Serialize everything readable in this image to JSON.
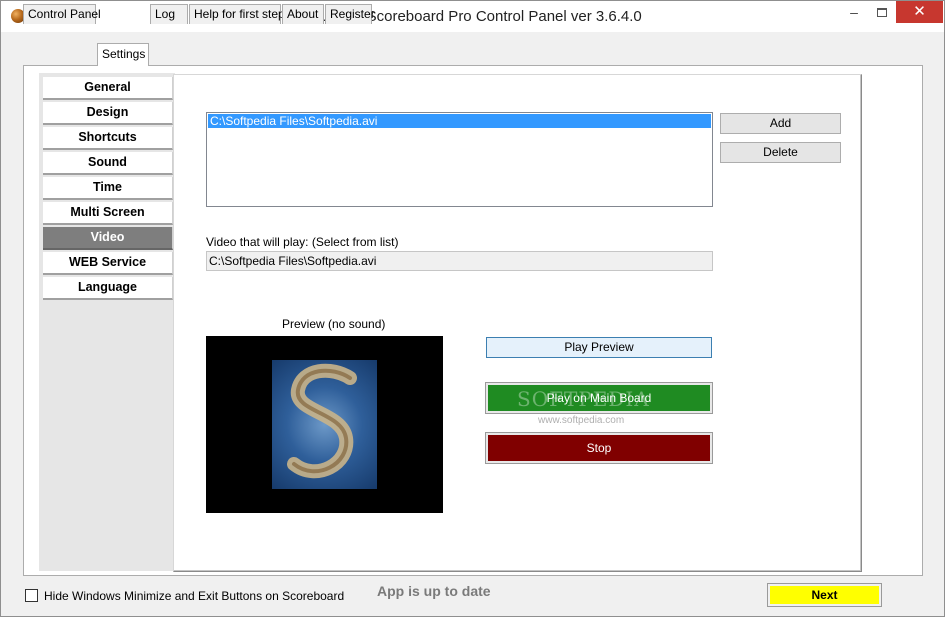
{
  "window": {
    "title": "Eguasoft Scoreboard Pro Control Panel ver 3.6.4.0",
    "minimize_glyph": "–",
    "close_glyph": "✕"
  },
  "tabs": [
    {
      "label": "Control Panel"
    },
    {
      "label": "Settings",
      "active": true
    },
    {
      "label": "Log"
    },
    {
      "label": "Help for first step"
    },
    {
      "label": "About"
    },
    {
      "label": "Register"
    }
  ],
  "sidebar": {
    "items": [
      {
        "label": "General"
      },
      {
        "label": "Design"
      },
      {
        "label": "Shortcuts"
      },
      {
        "label": "Sound"
      },
      {
        "label": "Time"
      },
      {
        "label": "Multi Screen"
      },
      {
        "label": "Video",
        "selected": true
      },
      {
        "label": "WEB Service"
      },
      {
        "label": "Language"
      }
    ]
  },
  "video": {
    "list_items": [
      "C:\\Softpedia Files\\Softpedia.avi"
    ],
    "add_label": "Add",
    "delete_label": "Delete",
    "will_play_label": "Video that will play: (Select from list)",
    "will_play_value": "C:\\Softpedia Files\\Softpedia.avi",
    "preview_label": "Preview (no sound)",
    "play_preview_label": "Play Preview",
    "play_main_label": "Play on Main Board",
    "stop_label": "Stop",
    "watermark": "SOFTPEDIA",
    "watermark_url": "www.softpedia.com"
  },
  "bottom": {
    "hide_buttons_label": "Hide Windows Minimize and Exit Buttons on Scoreboard",
    "hide_buttons_checked": false,
    "status": "App is up to date",
    "next_label": "Next"
  },
  "colors": {
    "selected_nav": "#7e7e7e",
    "list_selection": "#3399ff",
    "play_main": "#1f8b22",
    "stop": "#800000",
    "next": "#ffff00"
  }
}
